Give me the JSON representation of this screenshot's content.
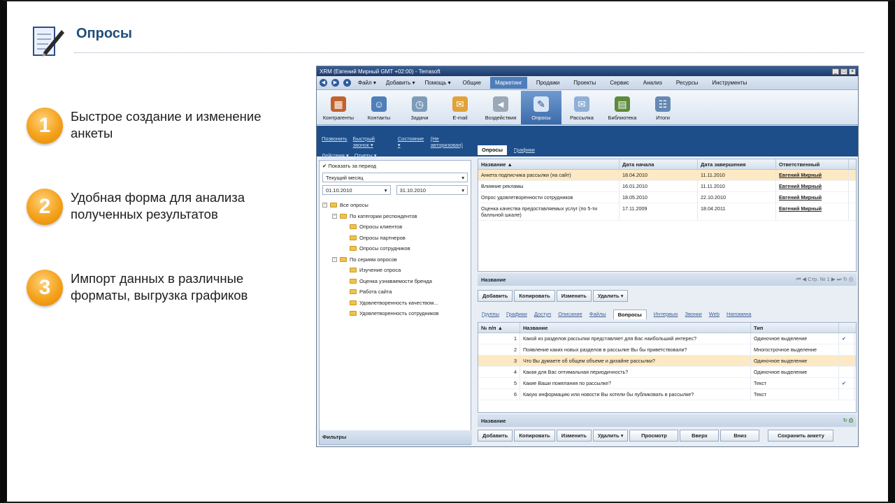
{
  "slide": {
    "title": "Опросы",
    "features": [
      {
        "num": "1",
        "text": "Быстрое создание и изменение анкеты"
      },
      {
        "num": "2",
        "text": "Удобная форма для анализа полученных результатов"
      },
      {
        "num": "3",
        "text": "Импорт данных в различные форматы, выгрузка графиков"
      }
    ]
  },
  "app": {
    "window_title": "XRM (Евгений Мирный GMT +02:00) - Terrasoft",
    "menu": [
      "Файл ▾",
      "Добавить ▾",
      "Помощь ▾"
    ],
    "menu_tabs": [
      "Общие",
      "Маркетинг",
      "Продажи",
      "Проекты",
      "Сервис",
      "Анализ",
      "Ресурсы",
      "Инструменты"
    ],
    "active_menu_tab": "Маркетинг",
    "ribbon": [
      "Контрагенты",
      "Контакты",
      "Задачи",
      "E-mail",
      "Воздействия",
      "Опросы",
      "Рассылка",
      "Библиотека",
      "Итоги"
    ],
    "active_ribbon": "Опросы",
    "left_links_1": [
      "Позвонить",
      "Быстрый звонок ▾",
      "Состояние ▾",
      "(Не авторизован)"
    ],
    "left_links_2": [
      "Действия ▾",
      "Отчеты ▾"
    ],
    "show_period_label": "✔ Показать за период",
    "period_select": "Текущий месяц",
    "date_from": "01.10.2010",
    "date_to": "31.10.2010",
    "tree": [
      {
        "label": "Все опросы",
        "level": 0,
        "pm": "−"
      },
      {
        "label": "По категории респондентов",
        "level": 1,
        "pm": "−"
      },
      {
        "label": "Опросы клиентов",
        "level": 2,
        "pm": ""
      },
      {
        "label": "Опросы партнеров",
        "level": 2,
        "pm": ""
      },
      {
        "label": "Опросы сотрудников",
        "level": 2,
        "pm": ""
      },
      {
        "label": "По сериям опросов",
        "level": 1,
        "pm": "−"
      },
      {
        "label": "Изучение спроса",
        "level": 2,
        "pm": ""
      },
      {
        "label": "Оценка узнаваемости бренда",
        "level": 2,
        "pm": ""
      },
      {
        "label": "Работа сайта",
        "level": 2,
        "pm": ""
      },
      {
        "label": "Удовлетворенность качеством...",
        "level": 2,
        "pm": ""
      },
      {
        "label": "Удовлетворенность сотрудников",
        "level": 2,
        "pm": ""
      }
    ],
    "filters_label": "Фильтры",
    "main_tabs": [
      "Опросы",
      "Графики"
    ],
    "surveys_grid": {
      "headers": [
        "Название ▲",
        "Дата начала",
        "Дата завершения",
        "Ответственный"
      ],
      "rows": [
        [
          "Анкета подписчика рассылки (на сайт)",
          "18.04.2010",
          "11.11.2010",
          "Евгений Мирный"
        ],
        [
          "Влияние рекламы",
          "16.01.2010",
          "11.11.2010",
          "Евгений Мирный"
        ],
        [
          "Опрос удовлетворенности сотрудников",
          "18.05.2010",
          "22.10.2010",
          "Евгений Мирный"
        ],
        [
          "Оценка качества предоставляемых услуг (по 5-ти балльной шкале)",
          "17.11.2009",
          "18.04.2011",
          "Евгений Мирный"
        ]
      ],
      "footer": "Название",
      "pager": "Стр. № 1"
    },
    "grid_buttons": [
      "Добавить",
      "Копировать",
      "Изменить",
      "Удалить ▾"
    ],
    "sub_tabs": [
      "Группы",
      "Графики",
      "Доступ",
      "Описание",
      "Файлы",
      "Вопросы",
      "Интервью",
      "Звонки",
      "Web",
      "Напомина"
    ],
    "active_sub_tab": "Вопросы",
    "questions_grid": {
      "headers": [
        "№ п/п ▲",
        "Название",
        "Тип"
      ],
      "rows": [
        [
          "1",
          "Какой из разделов рассылки представляет для Вас наибольший интерес?",
          "Одиночное выделение",
          "✔"
        ],
        [
          "2",
          "Появление каких новых разделов в рассылке Вы бы приветствовали?",
          "Многострочное выделение",
          ""
        ],
        [
          "3",
          "Что Вы думаете об общем объеме и дизайне рассылки?",
          "Одиночное выделение",
          ""
        ],
        [
          "4",
          "Какая для Вас оптимальная периодичность?",
          "Одиночное выделение",
          ""
        ],
        [
          "5",
          "Какие Ваши пожелания по рассылке?",
          "Текст",
          "✔"
        ],
        [
          "6",
          "Какую информацию или новости Вы хотели бы публиковать в рассылке?",
          "Текст",
          ""
        ]
      ],
      "footer": "Название"
    },
    "bottom_buttons": [
      "Добавить",
      "Копировать",
      "Изменить",
      "Удалить ▾",
      "Просмотр",
      "Вверх",
      "Вниз",
      "Сохранить анкету"
    ]
  }
}
